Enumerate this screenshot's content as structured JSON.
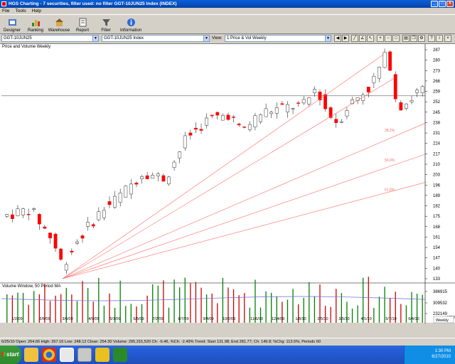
{
  "window": {
    "title": "HGS Charting - 7 securities, filter used: no filter        GGT-10JUN25 Index (INDEX)",
    "controls": [
      "_",
      "□",
      "×"
    ]
  },
  "menu": [
    "File",
    "Tools",
    "Help"
  ],
  "toolbar": [
    {
      "label": "Designer",
      "icon": "designer-icon"
    },
    {
      "label": "Ranking",
      "icon": "ranking-icon"
    },
    {
      "label": "Warehouse",
      "icon": "warehouse-icon"
    },
    {
      "label": "Report",
      "icon": "report-icon"
    },
    {
      "label": "Filter",
      "icon": "filter-icon"
    },
    {
      "label": "Information",
      "icon": "information-icon"
    }
  ],
  "selectors": {
    "security_left": "GGT-10JUN25",
    "security_mid": "GGT-10JUN25 Index",
    "view_label": "View:",
    "view_value": "1 Price & Vol Weekly"
  },
  "chart": {
    "price_panel_label": "Price and Volume Weekly",
    "volume_panel_label": "Volume Window, 50 Period MA",
    "price_ticks": [
      "287",
      "280",
      "273",
      "266",
      "259",
      "252",
      "245",
      "238",
      "231",
      "224",
      "217",
      "210",
      "203",
      "196",
      "189",
      "182",
      "175",
      "168",
      "161",
      "154",
      "147",
      "140",
      "133"
    ],
    "volume_ticks": [
      "386915",
      "309532",
      "232149"
    ],
    "volume_unit": "x1000",
    "date_ticks": [
      "1/2/09",
      "2/6/09",
      "3/6/09",
      "4/9/09",
      "5/1/09",
      "6/5/09",
      "7/2/09",
      "8/7/09",
      "9/4/09",
      "10/2/09",
      "11/6/09",
      "12/4/09",
      "1/8/10",
      "2/5/10",
      "3/5/10",
      "4/1/10",
      "5/7/10",
      "6/4/10"
    ],
    "gann_labels": [
      "38.2%",
      "50.0%",
      "61.8%"
    ],
    "period_label": "Weekly",
    "last_price_tag": "253.29",
    "colors": {
      "up": "#ffffff",
      "down": "#ff0000",
      "vol_up": "#008000",
      "vol_down": "#cc0000",
      "fan": "#ff6a6a",
      "ma": "#6a6ad8"
    }
  },
  "status": "6/25/10 Open: 264.66 High: 267.16 Low: 248.12 Close: 254.30 Volume: 295,315,520 Ch: -6.46, %Ch: -2.49% Trend: Start 131.98; End 281.77; Ch: 149.8; %Chg: 113.5%; Periods 60",
  "taskbar": {
    "start_label": "start",
    "apps": [
      "explorer-icon",
      "chrome-icon",
      "chart-app-icon",
      "hgs-icon",
      "excel-icon"
    ],
    "time": "1:30 PM",
    "date": "6/27/2010"
  }
}
